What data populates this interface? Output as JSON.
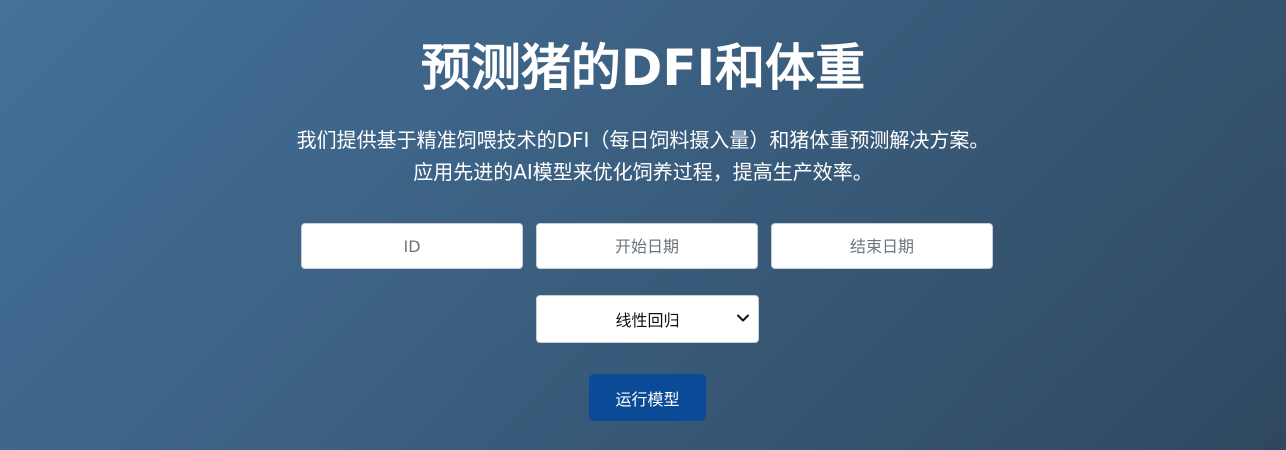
{
  "hero": {
    "title": "预测猪的DFI和体重",
    "subtitle_line1": "我们提供基于精准饲喂技术的DFI（每日饲料摄入量）和猪体重预测解决方案。",
    "subtitle_line2": "应用先进的AI模型来优化饲养过程，提高生产效率。"
  },
  "form": {
    "id_placeholder": "ID",
    "start_date_placeholder": "开始日期",
    "end_date_placeholder": "结束日期",
    "model_select": {
      "selected": "线性回归"
    },
    "run_button_label": "运行模型"
  },
  "colors": {
    "background_start": "#44709a",
    "background_end": "#2f4860",
    "button": "#0b4a96",
    "text": "#ffffff"
  },
  "icons": {
    "select_arrow": "chevron-down-icon"
  }
}
